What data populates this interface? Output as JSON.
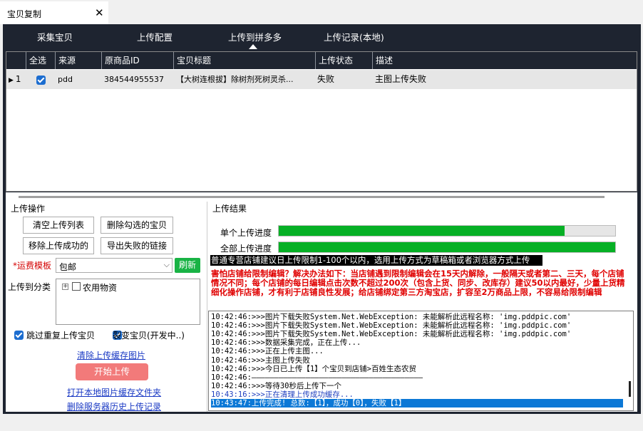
{
  "tab": {
    "title": "宝贝复制",
    "close": "✕"
  },
  "nav": {
    "items": [
      "采集宝贝",
      "上传配置",
      "上传到拼多多",
      "上传记录(本地)"
    ],
    "active_index": 2
  },
  "grid": {
    "headers": [
      "全选",
      "来源",
      "原商品ID",
      "宝贝标题",
      "上传状态",
      "描述"
    ],
    "rows": [
      {
        "index": "1",
        "source": "pdd",
        "id": "384544955537",
        "title": "【大树连根拔】除树剂死树灵杀...",
        "status": "失败",
        "desc": "主图上传失败"
      }
    ]
  },
  "upload_ops": {
    "section": "上传操作",
    "clear_list": "清空上传列表",
    "delete_checked": "删除勾选的宝贝",
    "remove_success": "移除上传成功的",
    "export_failed": "导出失败的链接",
    "freight_label_star": "*",
    "freight_label": "运费模板",
    "freight_value": "包邮",
    "refresh": "刷新",
    "category_label": "上传到分类",
    "category_tree_item": "农用物资",
    "skip_dup": "跳过重复上传宝贝",
    "split_variant": "裂变宝贝(开发中..)",
    "clear_cache": "清除上传缓存图片",
    "start": "开始上传",
    "open_cache_folder": "打开本地图片缓存文件夹",
    "delete_history": "删除服务器历史上传记录"
  },
  "results": {
    "section": "上传结果",
    "single_label": "单个上传进度",
    "single_progress": 0.85,
    "total_label": "全部上传进度",
    "total_progress": 1.0,
    "notice": "普通专营店铺建议日上传限制1-100个以内，选用上传方式为草稿箱或者浏览器方式上传",
    "warning": "害怕店铺给限制编辑？解决办法如下：当店铺遇到限制编辑会在15天内解除，一般隔天或者第二、三天，每个店铺情况不同；每个店铺的每日编辑点击次数不超过200次（包含上货、同步、改库存）建议50以内最好，少量上货精细化操作店铺，才有利于店铺良性发展；给店铺绑定第三方淘宝店，扩容至2万商品上限，不容易给限制编辑"
  },
  "log": [
    {
      "text": "10:42:46:>>>图片下载失败System.Net.WebException: 未能解析此远程名称: 'img.pddpic.com'",
      "color": "#000000"
    },
    {
      "text": "10:42:46:>>>图片下载失败System.Net.WebException: 未能解析此远程名称: 'img.pddpic.com'",
      "color": "#000000"
    },
    {
      "text": "10:42:46:>>>图片下载失败System.Net.WebException: 未能解析此远程名称: 'img.pddpic.com'",
      "color": "#000000"
    },
    {
      "text": "10:42:46:>>>数据采集完成，正在上传...",
      "color": "#000000"
    },
    {
      "text": "10:42:46:>>>正在上传主图...",
      "color": "#000000"
    },
    {
      "text": "10:42:46:>>>主图上传失败",
      "color": "#000000"
    },
    {
      "text": "10:42:46:>>>今日已上传【1】个宝贝到店铺>百姓生态农贸",
      "color": "#000000"
    },
    {
      "text": "10:42:46:——————————————————————————————————————",
      "color": "#000000"
    },
    {
      "text": "10:42:46:>>>等待30秒后上传下一个",
      "color": "#000000"
    },
    {
      "text": "10:43:16:>>>正在清理上传成功缓存...",
      "color": "#1f3fbf"
    },
    {
      "text": "10:43:47:上传完成! 总数:【1】，成功【0】，失败【1】",
      "color": "#ffffff"
    }
  ],
  "colors": {
    "nav_bg": "#1e2430",
    "progress": "#06b025",
    "warn": "#e00000",
    "start_btn": "#f27a7a",
    "refresh_btn": "#19b345"
  }
}
